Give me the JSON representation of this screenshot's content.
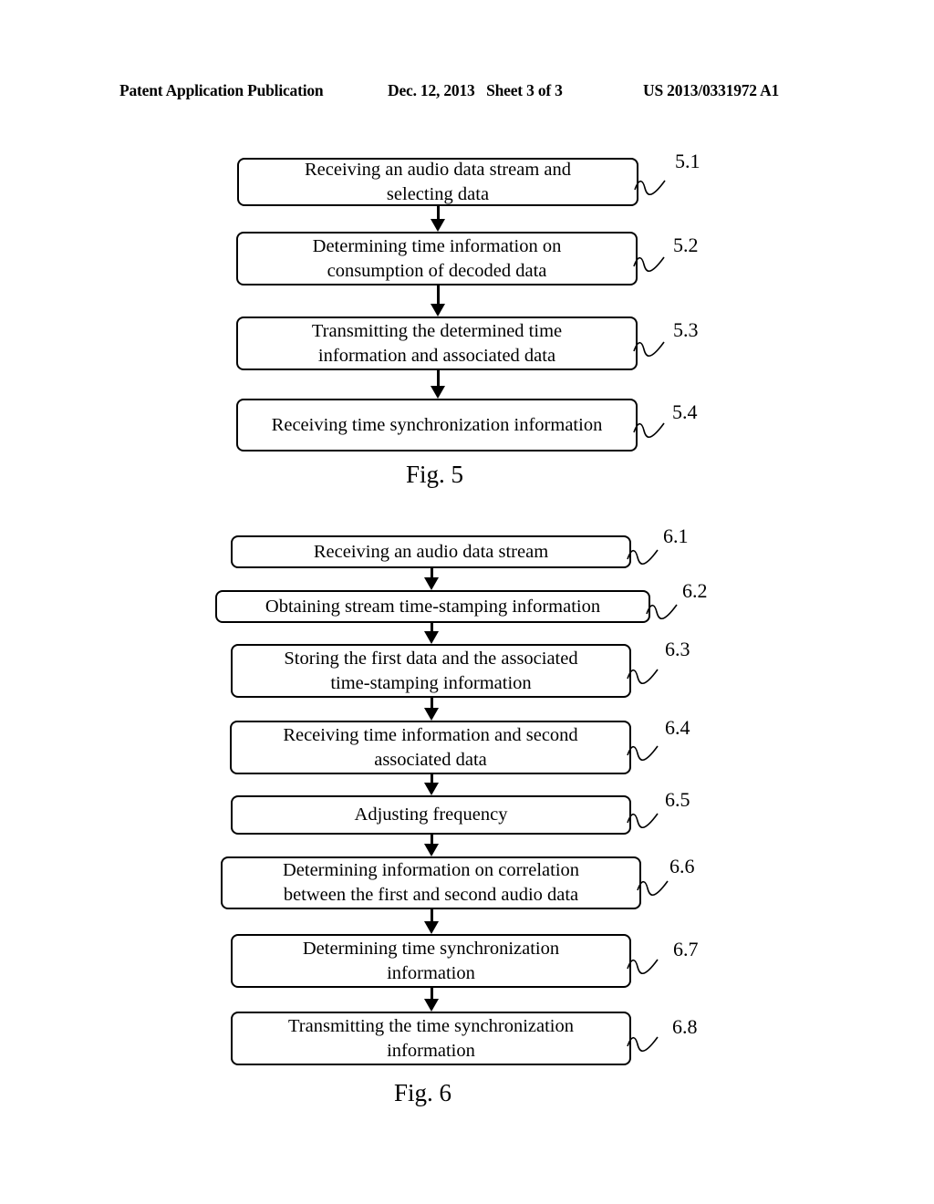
{
  "header": {
    "left": "Patent Application Publication",
    "middle": "Dec. 12, 2013   Sheet 3 of 3",
    "right": "US 2013/0331972 A1"
  },
  "fig5": {
    "caption": "Fig. 5",
    "steps": [
      {
        "ref": "5.1",
        "lines": [
          "Receiving an audio data stream and",
          "selecting data"
        ]
      },
      {
        "ref": "5.2",
        "lines": [
          "Determining time information on",
          "consumption of decoded data"
        ]
      },
      {
        "ref": "5.3",
        "lines": [
          "Transmitting the determined time",
          "information and associated data"
        ]
      },
      {
        "ref": "5.4",
        "lines": [
          "Receiving time synchronization information"
        ]
      }
    ]
  },
  "fig6": {
    "caption": "Fig. 6",
    "steps": [
      {
        "ref": "6.1",
        "lines": [
          "Receiving an audio data stream"
        ]
      },
      {
        "ref": "6.2",
        "lines": [
          "Obtaining stream time-stamping information"
        ]
      },
      {
        "ref": "6.3",
        "lines": [
          "Storing the first data and the associated",
          "time-stamping information"
        ]
      },
      {
        "ref": "6.4",
        "lines": [
          "Receiving time information and second",
          "associated data"
        ]
      },
      {
        "ref": "6.5",
        "lines": [
          "Adjusting frequency"
        ]
      },
      {
        "ref": "6.6",
        "lines": [
          "Determining information on correlation",
          "between the first and second audio data"
        ]
      },
      {
        "ref": "6.7",
        "lines": [
          "Determining time synchronization",
          "information"
        ]
      },
      {
        "ref": "6.8",
        "lines": [
          "Transmitting the time synchronization",
          "information"
        ]
      }
    ]
  }
}
